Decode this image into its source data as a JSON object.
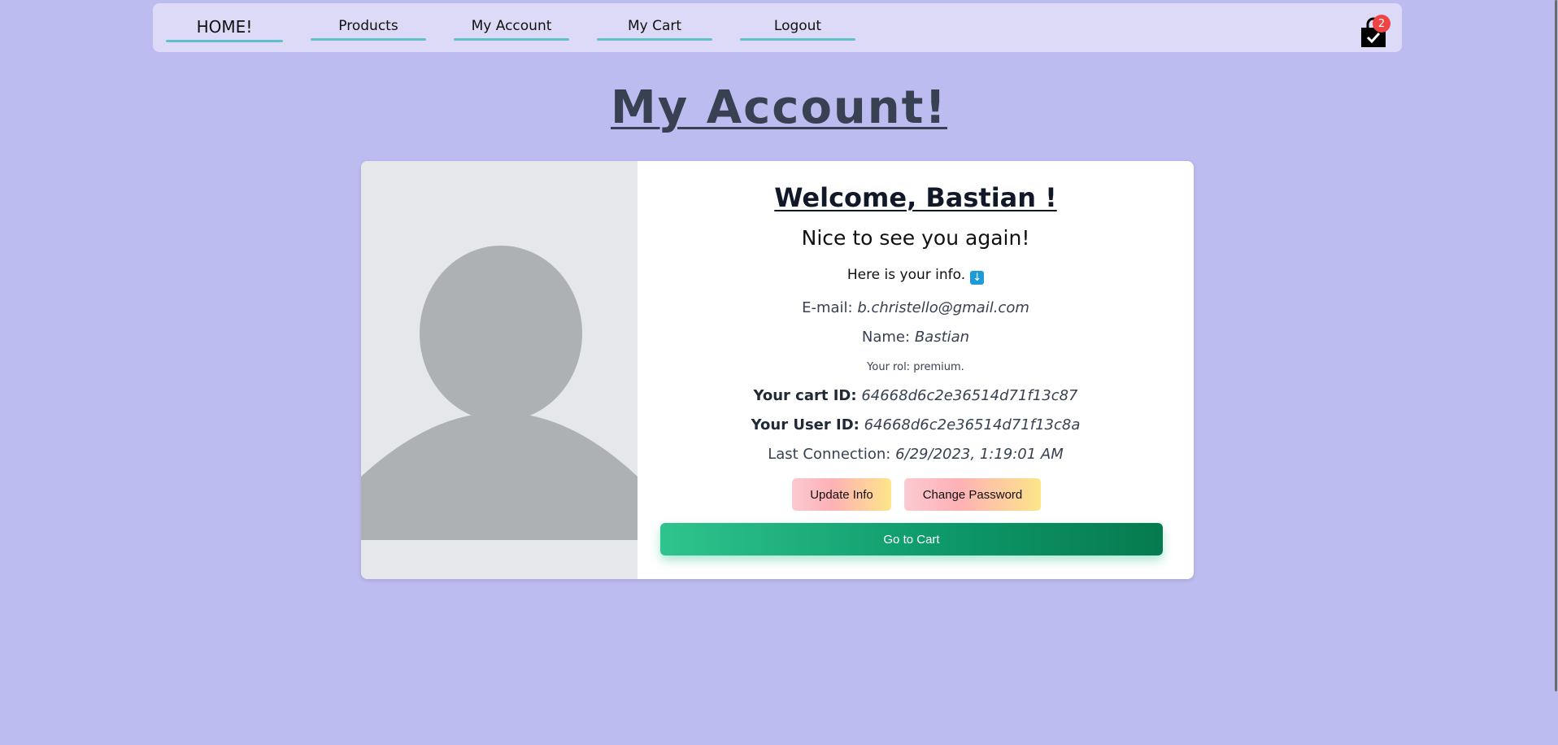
{
  "nav": {
    "home": "HOME!",
    "products": "Products",
    "account": "My Account",
    "cart": "My Cart",
    "logout": "Logout",
    "cart_count": "2",
    "cart_icon": "shopping-bag-check-icon"
  },
  "page": {
    "title": "My Account!"
  },
  "profile": {
    "avatar_icon": "user-placeholder-icon",
    "welcome": "Welcome, Bastian !",
    "nice": "Nice to see you again!",
    "here": "Here is your info.",
    "arrow_icon": "down-arrow-icon",
    "email_label": "E-mail:",
    "email": "b.christello@gmail.com",
    "name_label": "Name:",
    "name": "Bastian",
    "role": "Your rol: premium.",
    "cart_id_label": "Your cart ID:",
    "cart_id": "64668d6c2e36514d71f13c87",
    "user_id_label": "Your User ID:",
    "user_id": "64668d6c2e36514d71f13c8a",
    "last_label": "Last Connection:",
    "last": "6/29/2023, 1:19:01 AM"
  },
  "buttons": {
    "update": "Update Info",
    "password": "Change Password",
    "go_cart": "Go to Cart"
  },
  "colors": {
    "background": "#bdbcf0",
    "navbar": "#dcdaf6",
    "nav_underline": "#5fbfca",
    "badge": "#ef4444",
    "cart_button": "#0e9a6b"
  }
}
